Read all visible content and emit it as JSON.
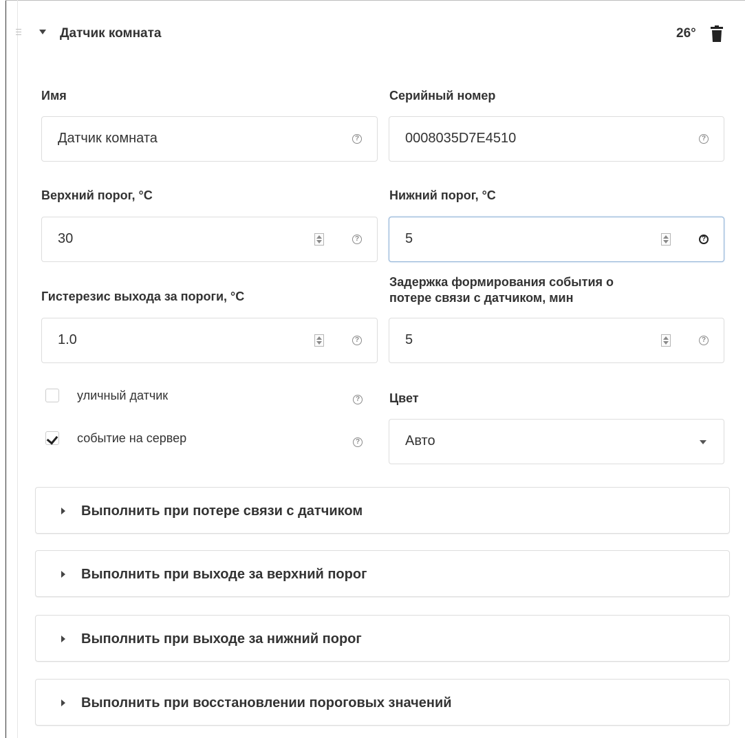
{
  "header": {
    "title": "Датчик комната",
    "temperature": "26°",
    "icons": [
      "drag-handle-icon",
      "caret-down-icon",
      "trash-icon"
    ]
  },
  "form": {
    "name": {
      "label": "Имя",
      "value": "Датчик комната"
    },
    "serial": {
      "label": "Серийный номер",
      "value": "0008035D7E4510"
    },
    "upper_threshold": {
      "label": "Верхний порог, °C",
      "value": "30"
    },
    "lower_threshold": {
      "label": "Нижний порог, °C",
      "value": "5"
    },
    "hysteresis": {
      "label": "Гистерезис выхода за пороги, °C",
      "value": "1.0"
    },
    "delay": {
      "label_line1": "Задержка формирования события о",
      "label_line2": "потере связи с датчиком, мин",
      "value": "5"
    },
    "outdoor_sensor": {
      "label": "уличный датчик",
      "checked": false
    },
    "server_event": {
      "label": "событие на сервер",
      "checked": true
    },
    "color": {
      "label": "Цвет",
      "value": "Авто"
    },
    "help_glyph": "?"
  },
  "sections": [
    {
      "title": "Выполнить при потере связи с датчиком"
    },
    {
      "title": "Выполнить при выходе за верхний порог"
    },
    {
      "title": "Выполнить при выходе за нижний порог"
    },
    {
      "title": "Выполнить при восстановлении пороговых значений"
    }
  ],
  "colors": {
    "focus_border": "#8fb1d6",
    "text": "#333333",
    "border": "#dddddd"
  }
}
